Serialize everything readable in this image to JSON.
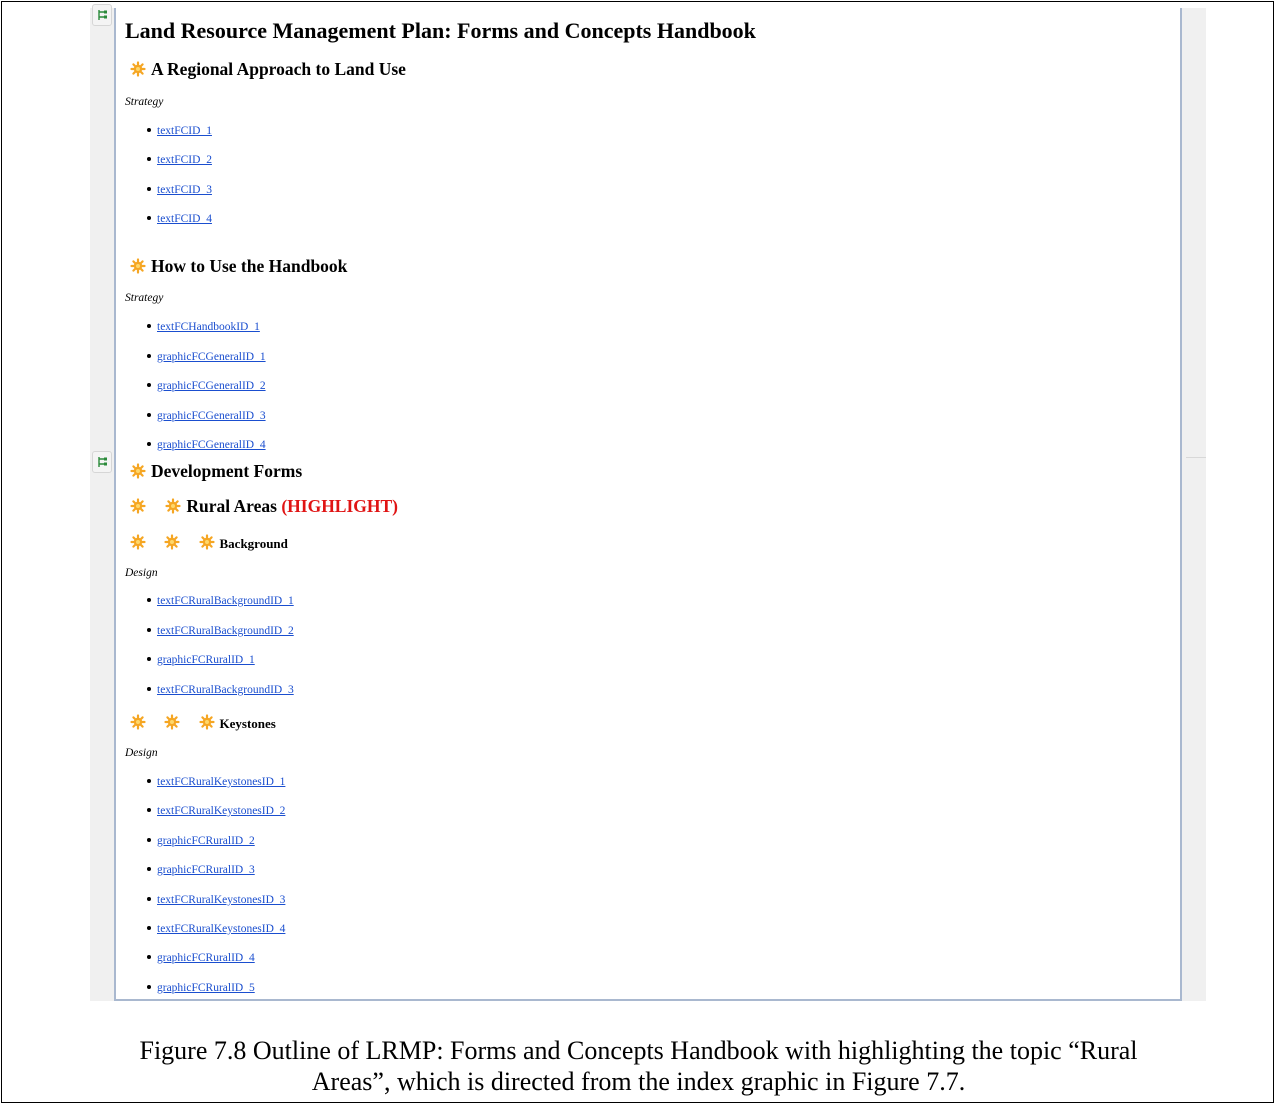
{
  "document": {
    "title": "Land Resource Management Plan: Forms and Concepts Handbook",
    "sections": [
      {
        "heading": "A Regional Approach to Land Use",
        "label": "Strategy",
        "items": [
          "textFCID_1",
          "textFCID_2",
          "textFCID_3",
          "textFCID_4"
        ]
      },
      {
        "heading": "How to Use the Handbook",
        "label": "Strategy",
        "items": [
          "textFCHandbookID_1",
          "graphicFCGeneralID_1",
          "graphicFCGeneralID_2",
          "graphicFCGeneralID_3",
          "graphicFCGeneralID_4"
        ]
      },
      {
        "heading": "Development Forms"
      },
      {
        "heading": "Rural Areas",
        "highlight": "(HIGHLIGHT)"
      },
      {
        "heading": "Background",
        "label": "Design",
        "items": [
          "textFCRuralBackgroundID_1",
          "textFCRuralBackgroundID_2",
          "graphicFCRuralID_1",
          "textFCRuralBackgroundID_3"
        ]
      },
      {
        "heading": "Keystones",
        "label": "Design",
        "items": [
          "textFCRuralKeystonesID_1",
          "textFCRuralKeystonesID_2",
          "graphicFCRuralID_2",
          "graphicFCRuralID_3",
          "textFCRuralKeystonesID_3",
          "textFCRuralKeystonesID_4",
          "graphicFCRuralID_4",
          "graphicFCRuralID_5"
        ]
      }
    ]
  },
  "icons": {
    "section_icon": "gear-icon",
    "gutter_icon": "tree-toggle-icon"
  },
  "colors": {
    "link": "#1a4ecf",
    "highlight": "#e01414",
    "gear": "#f5a623"
  },
  "caption": {
    "line1": "Figure 7.8 Outline of LRMP: Forms and Concepts Handbook with highlighting the topic “Rural",
    "line2": "Areas”, which is directed from the index graphic in Figure 7.7."
  }
}
